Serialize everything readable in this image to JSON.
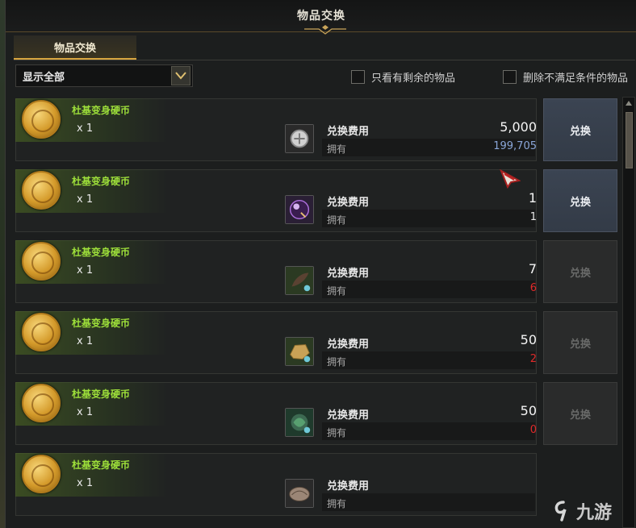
{
  "window": {
    "title": "物品交换"
  },
  "tab": {
    "label": "物品交换"
  },
  "filter": {
    "dropdown_value": "显示全部",
    "check_remaining": "只看有剩余的物品",
    "check_remove_unmet": "删除不满足条件的物品"
  },
  "labels": {
    "cost": "兑换费用",
    "own": "拥有",
    "exchange": "兑换"
  },
  "rows": [
    {
      "reward": "杜基变身硬币",
      "qty": "x 1",
      "cost": "5,000",
      "own": "199,705",
      "own_state": "blue",
      "button_enabled": true,
      "cost_icon": "silver-coin-icon"
    },
    {
      "reward": "杜基变身硬币",
      "qty": "x 1",
      "cost": "1",
      "own": "1",
      "own_state": "ok",
      "button_enabled": true,
      "cost_icon": "dark-orb-icon"
    },
    {
      "reward": "杜基变身硬币",
      "qty": "x 1",
      "cost": "7",
      "own": "6",
      "own_state": "red",
      "button_enabled": false,
      "cost_icon": "feather-material-icon"
    },
    {
      "reward": "杜基变身硬币",
      "qty": "x 1",
      "cost": "50",
      "own": "2",
      "own_state": "red",
      "button_enabled": false,
      "cost_icon": "ore-material-icon"
    },
    {
      "reward": "杜基变身硬币",
      "qty": "x 1",
      "cost": "50",
      "own": "0",
      "own_state": "red",
      "button_enabled": false,
      "cost_icon": "herb-material-icon"
    },
    {
      "reward": "杜基变身硬币",
      "qty": "x 1",
      "cost": "",
      "own": "",
      "own_state": "ok",
      "button_enabled": false,
      "cost_icon": "shell-material-icon"
    }
  ],
  "watermark": {
    "text": "九游"
  },
  "colors": {
    "accent_gold": "#d9a640",
    "reward_green": "#9ee03a",
    "insufficient_red": "#e02a2a",
    "owned_blue": "#8aa6d8"
  }
}
